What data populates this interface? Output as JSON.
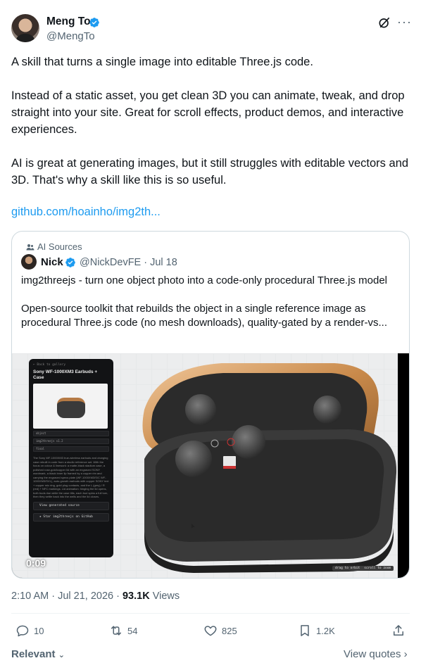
{
  "author": {
    "name": "Meng To",
    "handle": "@MengTo"
  },
  "tweet": {
    "paragraphs": [
      "A skill that turns a single image into editable Three.js code.",
      "Instead of a static asset, you get clean 3D you can animate, tweak, and drop straight into your site. Great for scroll effects, product demos, and interactive experiences.",
      "AI is great at generating images, but it still struggles with editable vectors and 3D. That's why a skill like this is so useful."
    ],
    "link": "github.com/hoainho/img2th..."
  },
  "quote": {
    "sources_label": "AI Sources",
    "author_name": "Nick",
    "meta": "@NickDevFE · Jul 18",
    "paragraphs": [
      "img2threejs - turn one object photo into a code-only procedural Three.js model",
      "Open-source toolkit that rebuilds the object in a single reference image as procedural Three.js code (no mesh downloads), quality-gated by a render-vs..."
    ],
    "video": {
      "timestamp": "0:09",
      "panel": {
        "back": "← Back to gallery",
        "title": "Sony WF-1000XM3 Earbuds + Case",
        "fields": [
          "object",
          "img2threejs v1.2",
          "final"
        ],
        "description": "The Sony WF-1000XM3 true-wireless earbuds and charging case rebuilt in code from a studio reference set. With the focus on colour & linework: a matte-black stadium case, a polished rose-gold/copper lid with an engraved SONY wordmark, a black inner lip framed by a copper rim and carrying the engraved specs plate (WF-1000XM3/S/C WF-1000XM3/SVL), auto-growth earbuds with copper SONY text + copper mic ring, gold plug contacts, and the L (grey) / R (red) + NFC markings. Lid animation: hinging the lid opens, both buds rise while the case tilts, each bud spins a full turn, then they settle back into the wells and the lid closes.",
        "button_source": "View generated source",
        "button_github": "★ Star img2threejs on GitHub"
      },
      "controls_hint": [
        "drag to orbit",
        "scroll to zoom"
      ]
    }
  },
  "post_meta": {
    "time": "2:10 AM · Jul 21, 2026 · ",
    "views_count": "93.1K",
    "views_label": " Views"
  },
  "actions": {
    "replies": "10",
    "reposts": "54",
    "likes": "825",
    "bookmarks": "1.2K"
  },
  "footer": {
    "relevant": "Relevant",
    "view_quotes": "View quotes"
  },
  "colors": {
    "accent": "#1d9bf0",
    "secondary_text": "#536471",
    "primary_text": "#0f1419",
    "copper": "#c98a4b"
  }
}
